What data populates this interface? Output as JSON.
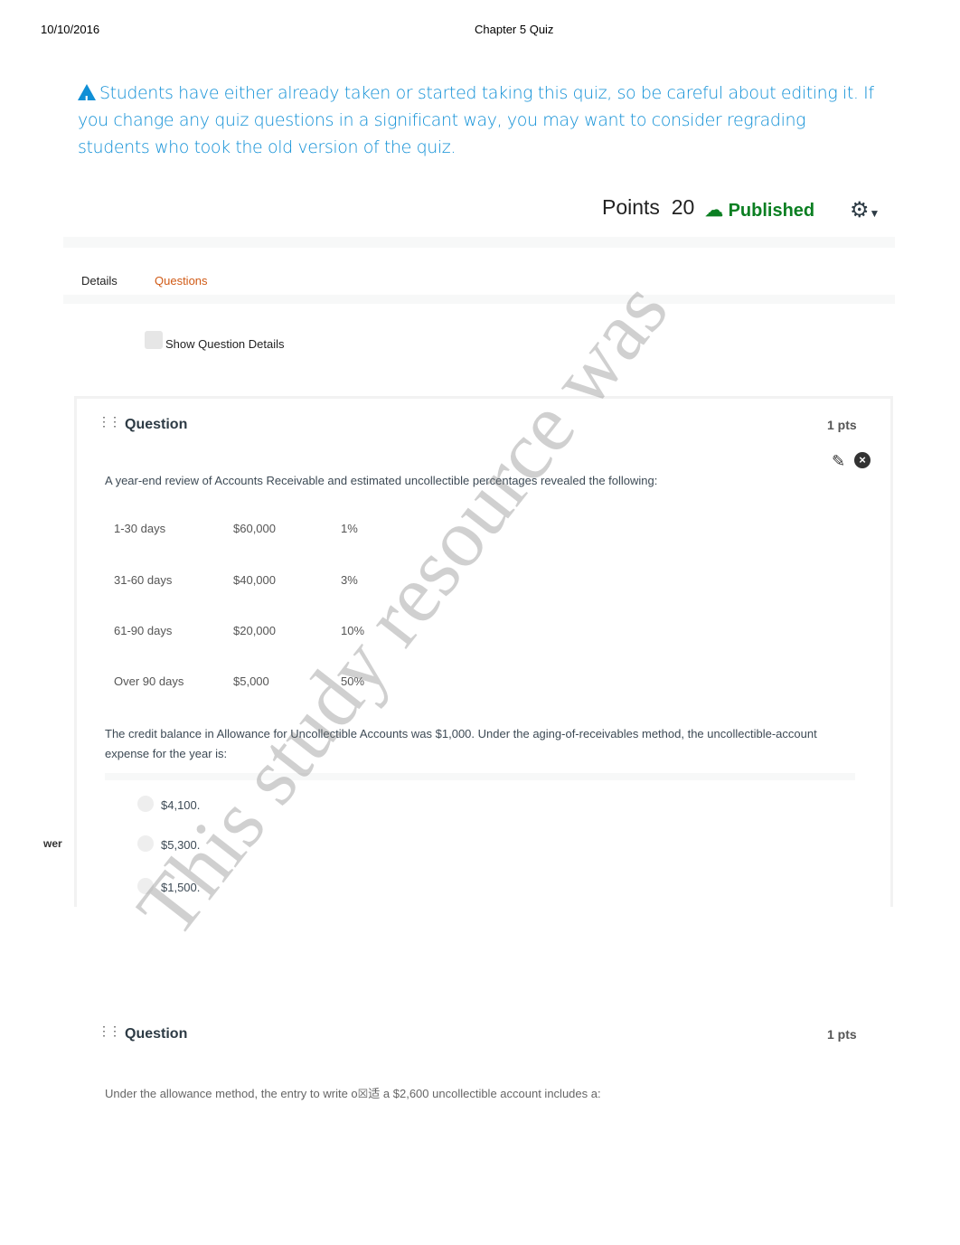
{
  "header": {
    "date": "10/10/2016",
    "title": "Chapter 5 Quiz"
  },
  "warning": {
    "icon": "warning-triangle-icon",
    "text": "Students have either already taken or started taking this quiz, so be careful about editing it. If you change any quiz questions in a significant way, you may want to consider regrading students who took the old version of the quiz."
  },
  "status": {
    "points_label": "Points",
    "points_value": "20",
    "published": "Published",
    "published_color": "#0b7f22"
  },
  "tabs": [
    {
      "label": "Details"
    },
    {
      "label": "Questions"
    }
  ],
  "show_details": "Show Question Details",
  "questions": [
    {
      "title": "Question",
      "pts": "1 pts",
      "prompt": "A year-end review of Accounts Receivable and estimated uncollectible percentages revealed the following:",
      "table": [
        [
          "1-30 days",
          "$60,000",
          "1%"
        ],
        [
          "31-60 days",
          "$40,000",
          "3%"
        ],
        [
          "61-90 days",
          "$20,000",
          "10%"
        ],
        [
          "Over 90 days",
          "$5,000",
          "50%"
        ]
      ],
      "followup": "The credit balance in Allowance for Uncollectible Accounts was $1,000. Under the aging-of-receivables method, the uncollectible-account expense for the year is:",
      "answers": [
        "$4,100.",
        "$5,300.",
        "$1,500."
      ],
      "side_label": "wer"
    },
    {
      "title": "Question",
      "pts": "1 pts",
      "prompt": "Under the allowance method, the entry to write o☒适 a $2,600 uncollectible account includes a:"
    }
  ],
  "watermark": "This study resource was"
}
